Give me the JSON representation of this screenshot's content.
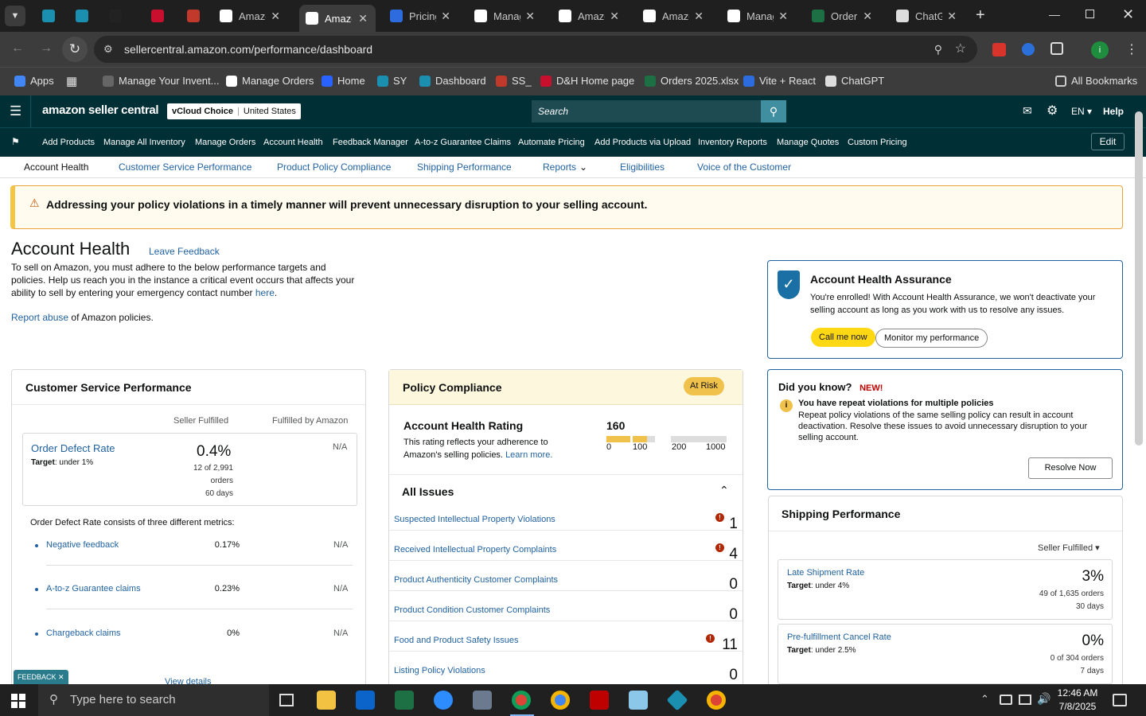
{
  "browser": {
    "tabs": [
      {
        "title": "",
        "favicon_color": "#1b8fb0",
        "active": false
      },
      {
        "title": "",
        "favicon_color": "#1b8fb0",
        "active": false
      },
      {
        "title": "",
        "favicon_color": "#222",
        "active": false
      },
      {
        "title": "",
        "favicon_color": "#c8102e",
        "active": false
      },
      {
        "title": "",
        "favicon_color": "#c0392b",
        "active": false
      },
      {
        "title": "Amazo",
        "favicon_color": "#fff",
        "active": false
      },
      {
        "title": "Amazo",
        "favicon_color": "#fff",
        "active": true
      },
      {
        "title": "Pricing",
        "favicon_color": "#2d6cdf",
        "active": false
      },
      {
        "title": "Manag",
        "favicon_color": "#fff",
        "active": false
      },
      {
        "title": "Amazo",
        "favicon_color": "#fff",
        "active": false
      },
      {
        "title": "Amazo",
        "favicon_color": "#fff",
        "active": false
      },
      {
        "title": "Manag",
        "favicon_color": "#fff",
        "active": false
      },
      {
        "title": "Order:",
        "favicon_color": "#1d7044",
        "active": false
      },
      {
        "title": "ChatG",
        "favicon_color": "#ddd",
        "active": false
      }
    ],
    "url": "sellercentral.amazon.com/performance/dashboard",
    "bookmarks": [
      "Apps",
      "Manage Your Invent...",
      "Manage Orders",
      "Home",
      "SY",
      "Dashboard",
      "SS_",
      "D&H Home page",
      "Orders 2025.xlsx",
      "Vite + React",
      "ChatGPT"
    ],
    "all_bookmarks": "All Bookmarks"
  },
  "sc": {
    "logo": "amazon seller central",
    "store": "vCloud Choice",
    "country": "United States",
    "search_placeholder": "Search",
    "lang": "EN",
    "help": "Help",
    "nav": [
      "Add Products",
      "Manage All Inventory",
      "Manage Orders",
      "Account Health",
      "Feedback Manager",
      "A-to-z Guarantee Claims",
      "Automate Pricing",
      "Add Products via Upload",
      "Inventory Reports",
      "Manage Quotes",
      "Custom Pricing"
    ],
    "edit": "Edit",
    "subnav": [
      "Account Health",
      "Customer Service Performance",
      "Product Policy Compliance",
      "Shipping Performance",
      "Reports",
      "Eligibilities",
      "Voice of the Customer"
    ]
  },
  "alert": "Addressing your policy violations in a timely manner will prevent unnecessary disruption to your selling account.",
  "intro": {
    "title": "Account Health",
    "leave_feedback": "Leave Feedback",
    "text": "To sell on Amazon, you must adhere to the below performance targets and policies. Help us reach you in the instance a critical event occurs that affects your ability to sell by entering your emergency contact number",
    "here": "here",
    "report_abuse": "Report abuse",
    "report_suffix": "of Amazon policies."
  },
  "assurance": {
    "title": "Account Health Assurance",
    "text": "You're enrolled! With Account Health Assurance, we won't deactivate your selling account as long as you work with us to resolve any issues.",
    "call": "Call me now",
    "monitor": "Monitor my performance"
  },
  "csp": {
    "title": "Customer Service Performance",
    "col1": "Seller Fulfilled",
    "col2": "Fulfilled by Amazon",
    "odr_label": "Order Defect Rate",
    "odr_target_label": "Target",
    "odr_target": ": under 1%",
    "odr_value": "0.4%",
    "odr_detail1": "12 of 2,991",
    "odr_detail2": "orders",
    "odr_detail3": "60 days",
    "odr_fba": "N/A",
    "consists": "Order Defect Rate consists of three different metrics:",
    "metrics": [
      {
        "name": "Negative feedback",
        "sf": "0.17%",
        "fba": "N/A"
      },
      {
        "name": "A-to-z Guarantee claims",
        "sf": "0.23%",
        "fba": "N/A"
      },
      {
        "name": "Chargeback claims",
        "sf": "0%",
        "fba": "N/A"
      }
    ],
    "view_details": "View details"
  },
  "policy": {
    "title": "Policy Compliance",
    "badge": "At Risk",
    "ahr_title": "Account Health Rating",
    "ahr_text": "This rating reflects your adherence to Amazon's selling policies.",
    "learn_more": "Learn more.",
    "score": "160",
    "score_fraction": 0.16,
    "scale": [
      "0",
      "100",
      "200",
      "1000"
    ],
    "all_issues": "All Issues",
    "issues": [
      {
        "name": "Suspected Intellectual Property Violations",
        "count": "1",
        "flag": true
      },
      {
        "name": "Received Intellectual Property Complaints",
        "count": "4",
        "flag": true
      },
      {
        "name": "Product Authenticity Customer Complaints",
        "count": "0",
        "flag": false
      },
      {
        "name": "Product Condition Customer Complaints",
        "count": "0",
        "flag": false
      },
      {
        "name": "Food and Product Safety Issues",
        "count": "11",
        "flag": true
      },
      {
        "name": "Listing Policy Violations",
        "count": "0",
        "flag": false
      }
    ]
  },
  "didyouknow": {
    "title": "Did you know?",
    "new": "NEW!",
    "head": "You have repeat violations for multiple policies",
    "text": "Repeat policy violations of the same selling policy can result in account deactivation. Resolve these issues to avoid unnecessary disruption to your selling account.",
    "button": "Resolve Now"
  },
  "shipping": {
    "title": "Shipping Performance",
    "filter": "Seller Fulfilled",
    "metrics": [
      {
        "name": "Late Shipment Rate",
        "target_label": "Target",
        "target": ": under 4%",
        "value": "3%",
        "d1": "49 of 1,635 orders",
        "d2": "30 days"
      },
      {
        "name": "Pre-fulfillment Cancel Rate",
        "target_label": "Target",
        "target": ": under 2.5%",
        "value": "0%",
        "d1": "0 of 304 orders",
        "d2": "7 days"
      }
    ]
  },
  "feedback_tab": "FEEDBACK",
  "taskbar": {
    "search": "Type here to search",
    "time": "12:46 AM",
    "date": "7/8/2025"
  }
}
